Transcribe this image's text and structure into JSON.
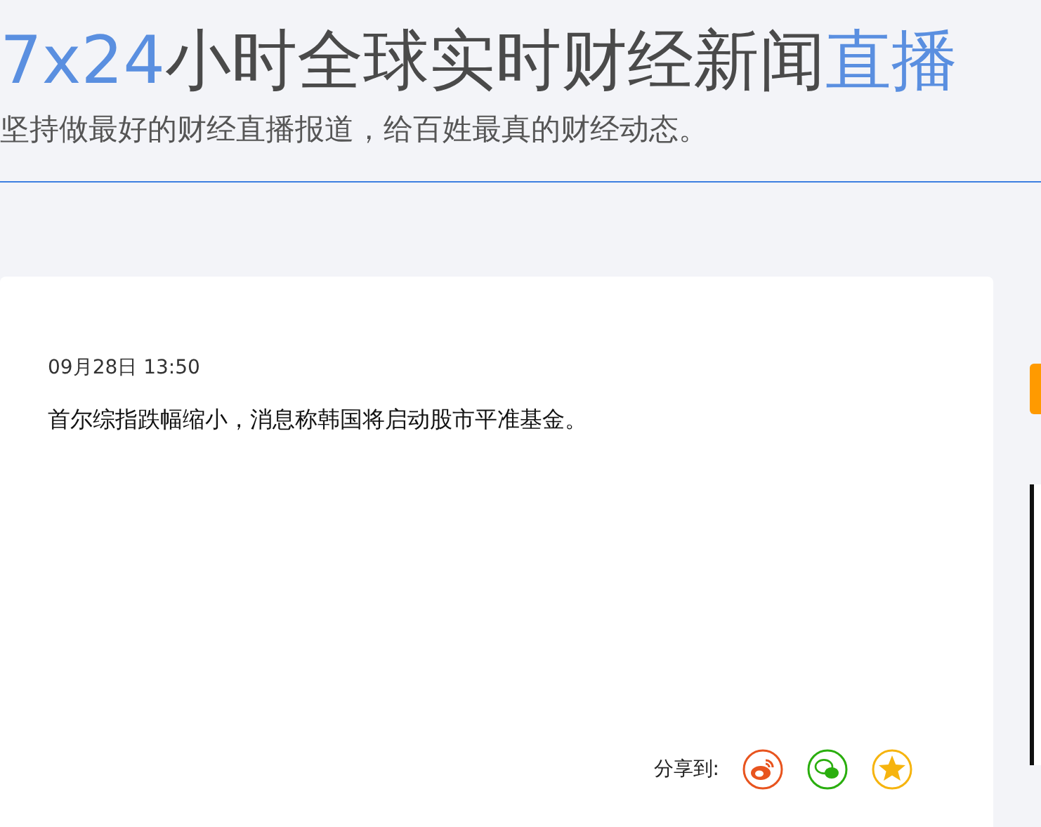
{
  "header": {
    "title_parts": [
      {
        "text": "7x24",
        "highlight": true
      },
      {
        "text": "小时全球实时财经新闻",
        "highlight": false
      },
      {
        "text": "直播",
        "highlight": true
      }
    ],
    "subtitle": "坚持做最好的财经直播报道，给百姓最真的财经动态。"
  },
  "news": [
    {
      "time": "09月28日 13:50",
      "text": "首尔综指跌幅缩小，消息称韩国将启动股市平准基金。"
    }
  ],
  "share": {
    "label": "分享到:",
    "targets": [
      {
        "kind": "weibo",
        "color": "#e8541e"
      },
      {
        "kind": "wechat",
        "color": "#2aae0e"
      },
      {
        "kind": "qzone",
        "color": "#f6b40e"
      }
    ]
  }
}
